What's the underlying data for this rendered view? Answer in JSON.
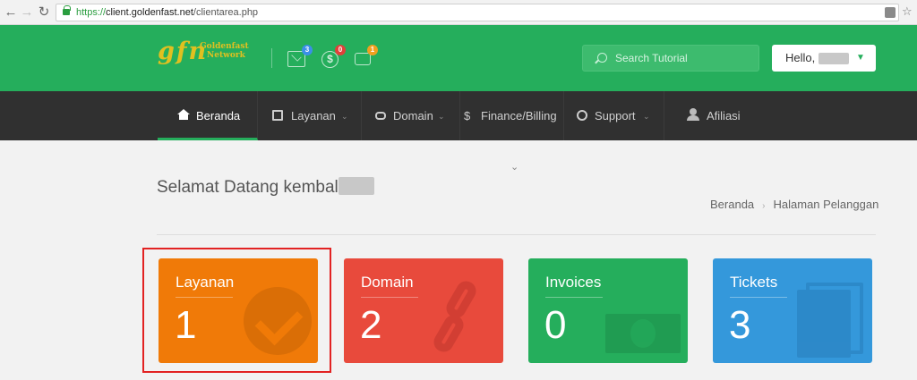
{
  "browser": {
    "url_protocol": "https://",
    "url_host": "client.goldenfast.net",
    "url_path": "/clientarea.php"
  },
  "header": {
    "logo_text": "gfn",
    "logo_line1": "Goldenfast",
    "logo_line2": "Network",
    "notifications": [
      {
        "icon": "mail-icon",
        "count": "3",
        "color": "#3b8fe8"
      },
      {
        "icon": "dollar-icon",
        "count": "0",
        "color": "#e2403a"
      },
      {
        "icon": "chat-icon",
        "count": "1",
        "color": "#f0a020"
      }
    ],
    "search_placeholder": "Search Tutorial",
    "hello_label": "Hello,"
  },
  "nav": {
    "items": [
      {
        "label": "Beranda",
        "icon": "home-icon"
      },
      {
        "label": "Layanan",
        "icon": "list-icon"
      },
      {
        "label": "Domain",
        "icon": "binoculars-icon"
      },
      {
        "label": "Finance/Billing",
        "icon": "dollar-icon"
      },
      {
        "label": "Support",
        "icon": "support-icon"
      },
      {
        "label": "Afiliasi",
        "icon": "user-icon"
      }
    ]
  },
  "content": {
    "welcome": "Selamat Datang kembali,",
    "breadcrumb": [
      "Beranda",
      "Halaman Pelanggan"
    ]
  },
  "tiles": [
    {
      "title": "Layanan",
      "count": "1",
      "color": "#f07a08"
    },
    {
      "title": "Domain",
      "count": "2",
      "color": "#e84a3c"
    },
    {
      "title": "Invoices",
      "count": "0",
      "color": "#25ae5c"
    },
    {
      "title": "Tickets",
      "count": "3",
      "color": "#3498db"
    }
  ],
  "colors": {
    "brand_green": "#25ae5c",
    "nav_dark": "#303030",
    "highlight_red": "#e22222"
  }
}
